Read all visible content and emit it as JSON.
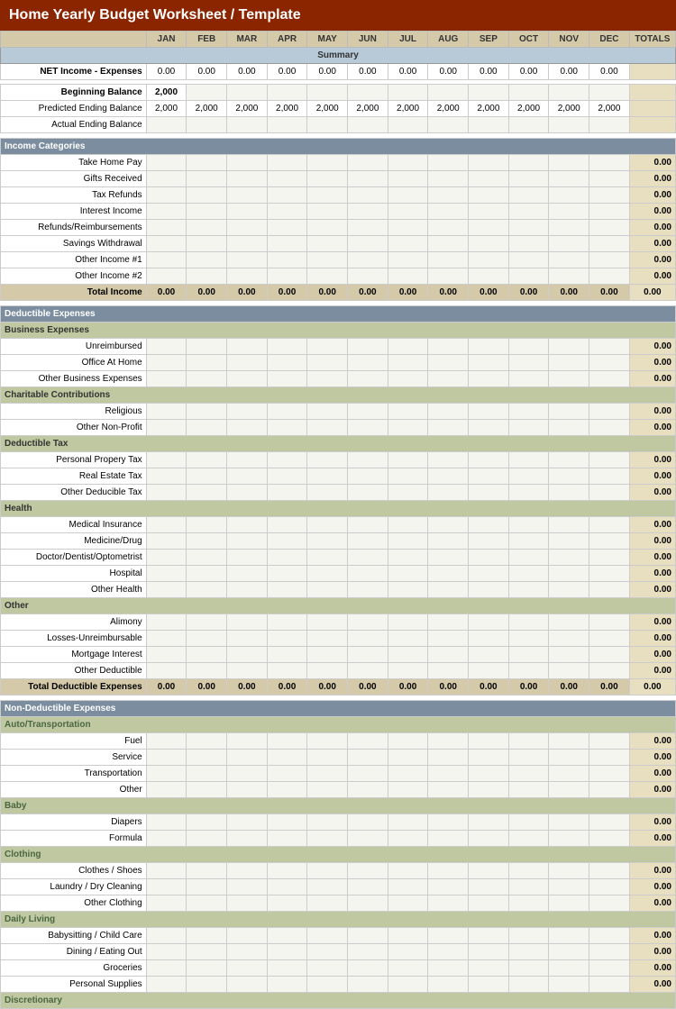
{
  "title": "Home Yearly Budget Worksheet / Template",
  "columns": {
    "label": "",
    "months": [
      "JAN",
      "FEB",
      "MAR",
      "APR",
      "MAY",
      "JUN",
      "JUL",
      "AUG",
      "SEP",
      "OCT",
      "NOV",
      "DEC",
      "TOTALS"
    ]
  },
  "summary": {
    "header": "Summary",
    "net_income_label": "NET Income - Expenses",
    "beg_balance_label": "Beginning Balance",
    "beg_balance_value": "2,000",
    "pred_ending_label": "Predicted Ending Balance",
    "pred_ending_value": "2,000",
    "actual_ending_label": "Actual Ending Balance"
  },
  "income": {
    "header": "Income Categories",
    "items": [
      "Take Home Pay",
      "Gifts Received",
      "Tax Refunds",
      "Interest Income",
      "Refunds/Reimbursements",
      "Savings Withdrawal",
      "Other Income #1",
      "Other Income #2"
    ],
    "total_label": "Total Income"
  },
  "deductible": {
    "header": "Deductible Expenses",
    "subsections": [
      {
        "name": "Business Expenses",
        "items": [
          "Unreimbursed",
          "Office At Home",
          "Other Business Expenses"
        ]
      },
      {
        "name": "Charitable Contributions",
        "items": [
          "Religious",
          "Other Non-Profit"
        ]
      },
      {
        "name": "Deductible Tax",
        "items": [
          "Personal Propery Tax",
          "Real Estate Tax",
          "Other Deducible Tax"
        ]
      },
      {
        "name": "Health",
        "items": [
          "Medical Insurance",
          "Medicine/Drug",
          "Doctor/Dentist/Optometrist",
          "Hospital",
          "Other Health"
        ]
      },
      {
        "name": "Other",
        "items": [
          "Alimony",
          "Losses-Unreimbursable",
          "Mortgage Interest",
          "Other Deductible"
        ]
      }
    ],
    "total_label": "Total Deductible Expenses"
  },
  "nondeductible": {
    "header": "Non-Deductible Expenses",
    "subsections": [
      {
        "name": "Auto/Transportation",
        "items": [
          "Fuel",
          "Service",
          "Transportation",
          "Other"
        ]
      },
      {
        "name": "Baby",
        "items": [
          "Diapers",
          "Formula"
        ]
      },
      {
        "name": "Clothing",
        "items": [
          "Clothes / Shoes",
          "Laundry / Dry Cleaning",
          "Other Clothing"
        ]
      },
      {
        "name": "Daily Living",
        "items": [
          "Babysitting / Child Care",
          "Dining / Eating Out",
          "Groceries",
          "Personal Supplies"
        ]
      },
      {
        "name": "Discretionary",
        "items": []
      }
    ]
  }
}
